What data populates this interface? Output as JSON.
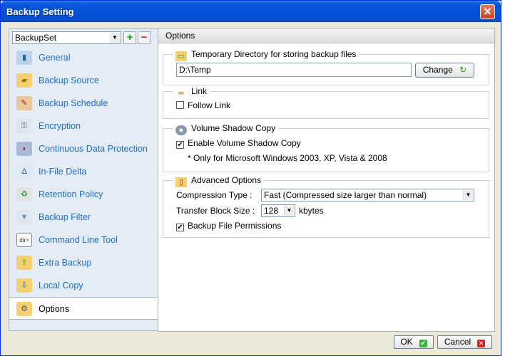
{
  "window": {
    "title": "Backup Setting"
  },
  "sidebar": {
    "backup_set": "BackupSet",
    "items": [
      {
        "label": "General",
        "icon": "general-icon"
      },
      {
        "label": "Backup Source",
        "icon": "folder-icon"
      },
      {
        "label": "Backup Schedule",
        "icon": "calendar-icon"
      },
      {
        "label": "Encryption",
        "icon": "key-icon"
      },
      {
        "label": "Continuous Data Protection",
        "icon": "shield-icon"
      },
      {
        "label": "In-File Delta",
        "icon": "delta-icon"
      },
      {
        "label": "Retention Policy",
        "icon": "recycle-icon"
      },
      {
        "label": "Backup Filter",
        "icon": "filter-icon"
      },
      {
        "label": "Command Line Tool",
        "icon": "terminal-icon"
      },
      {
        "label": "Extra Backup",
        "icon": "extra-backup-icon"
      },
      {
        "label": "Local Copy",
        "icon": "local-copy-icon"
      },
      {
        "label": "Options",
        "icon": "gear-icon"
      }
    ]
  },
  "main": {
    "header": "Options",
    "temp_dir": {
      "legend": "Temporary Directory for storing backup files",
      "path": "D:\\Temp",
      "change_label": "Change"
    },
    "link": {
      "legend": "Link",
      "follow_link": "Follow Link"
    },
    "vss": {
      "legend": "Volume Shadow Copy",
      "enable": "Enable Volume Shadow Copy",
      "note": "* Only for Microsoft Windows 2003, XP, Vista & 2008"
    },
    "advanced": {
      "legend": "Advanced Options",
      "compression_label": "Compression Type :",
      "compression_value": "Fast (Compressed size larger than normal)",
      "block_label": "Transfer Block Size :",
      "block_value": "128",
      "block_unit": "kbytes",
      "permissions": "Backup File Permissions"
    }
  },
  "footer": {
    "ok_label": "OK",
    "cancel_label": "Cancel"
  }
}
